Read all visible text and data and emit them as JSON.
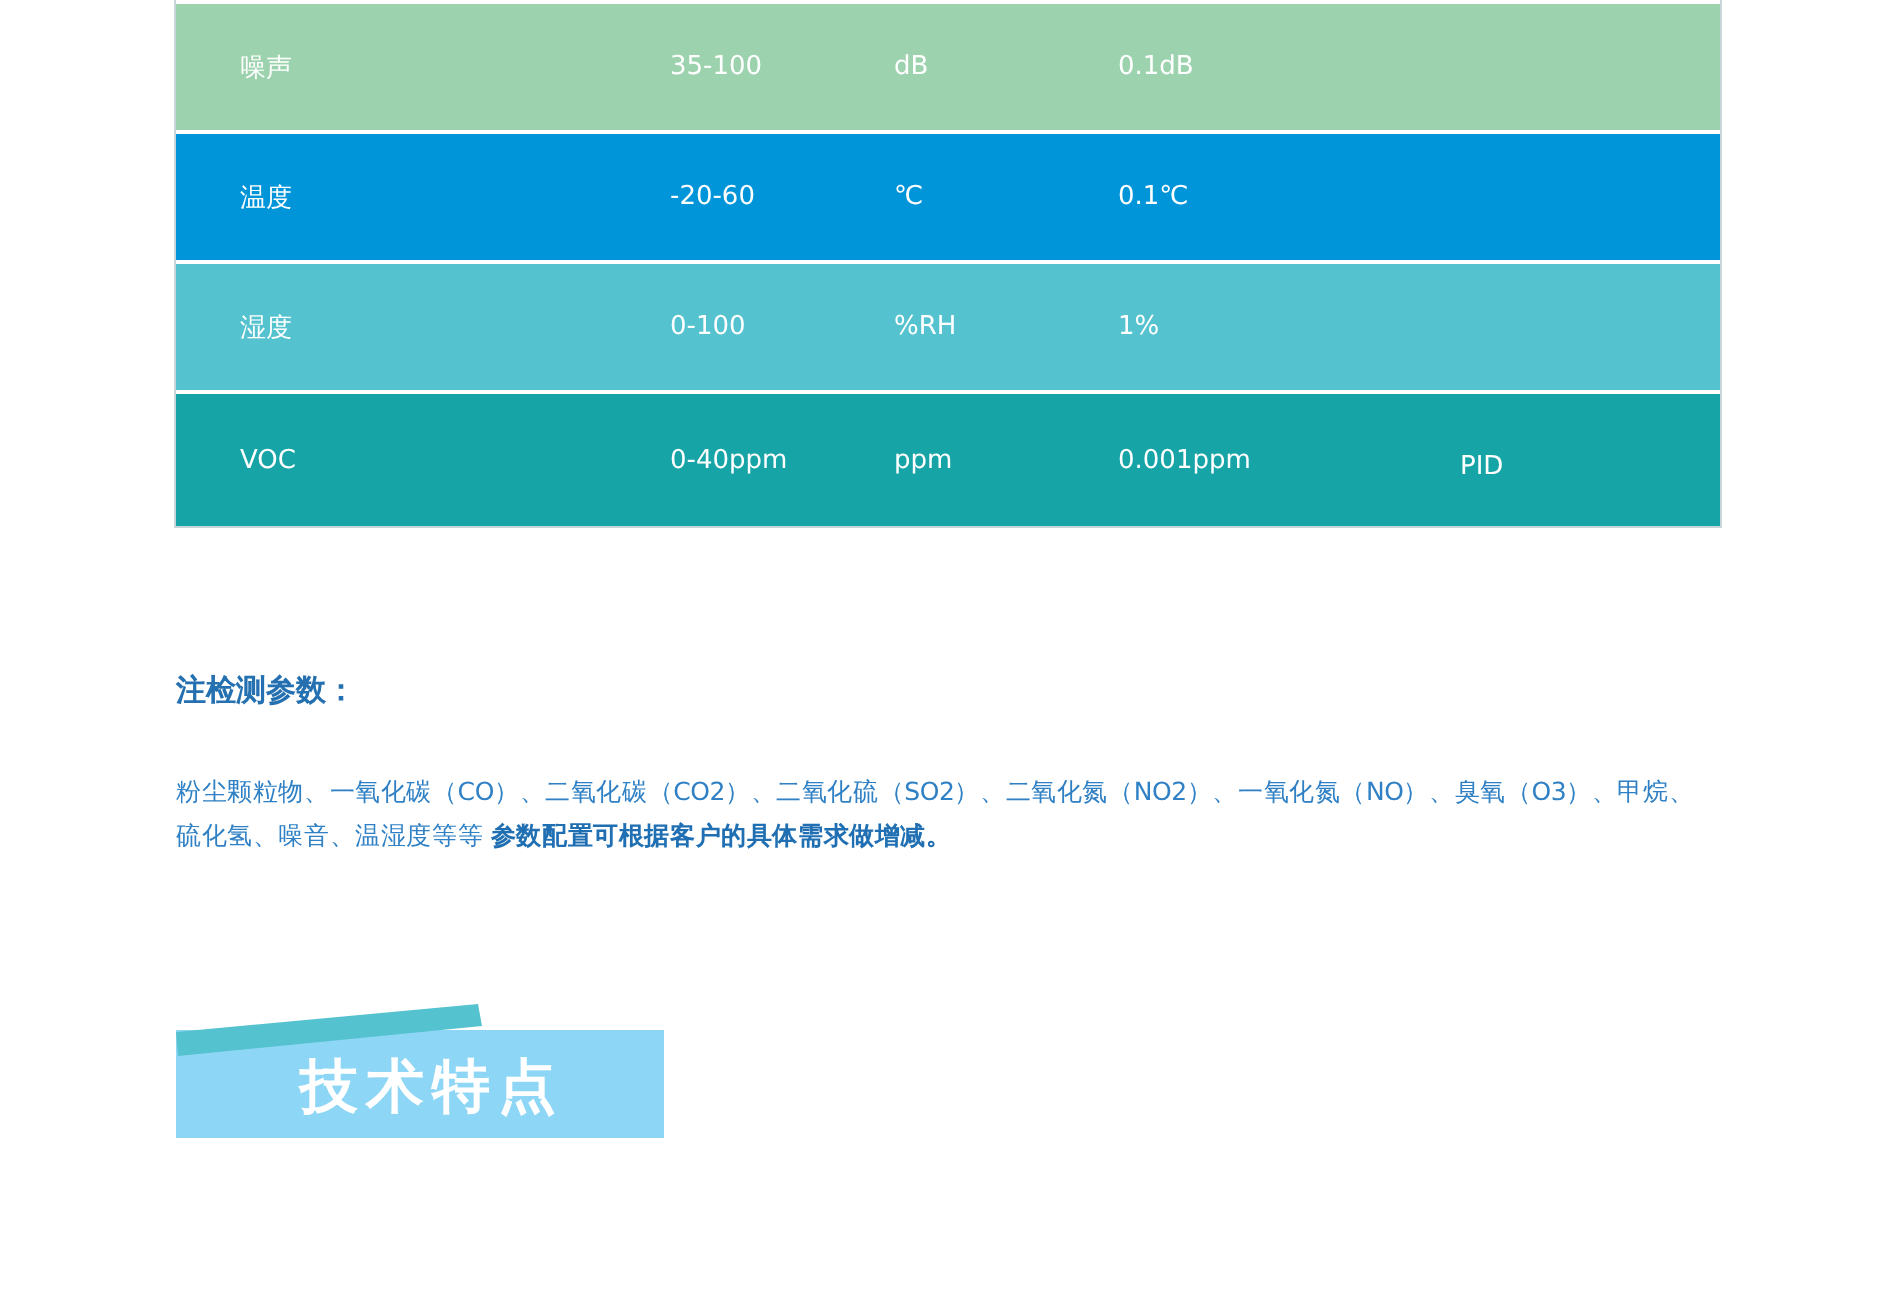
{
  "table": {
    "rows": [
      {
        "color": "#9cd3ae",
        "cells": [
          "噪声",
          "35-100",
          "dB",
          "0.1dB",
          ""
        ]
      },
      {
        "color": "#0095d9",
        "cells": [
          "温度",
          "-20-60",
          "℃",
          "0.1℃",
          ""
        ]
      },
      {
        "color": "#54c3cf",
        "cells": [
          "湿度",
          "0-100",
          "%RH",
          "1%",
          ""
        ]
      },
      {
        "color": "#17a4a7",
        "cells": [
          "VOC",
          "0-40ppm",
          "ppm",
          "0.001ppm",
          "PID"
        ]
      }
    ]
  },
  "note": {
    "heading": "注检测参数：",
    "text": "粉尘颗粒物、一氧化碳（CO）、二氧化碳（CO2）、二氧化硫（SO2）、二氧化氮（NO2）、一氧化氮（NO）、臭氧（O3）、甲烷、硫化氢、噪音、温湿度等等  **参数配置可根据客户的具体需求做增减。**"
  },
  "banner": {
    "title": "技术特点"
  }
}
